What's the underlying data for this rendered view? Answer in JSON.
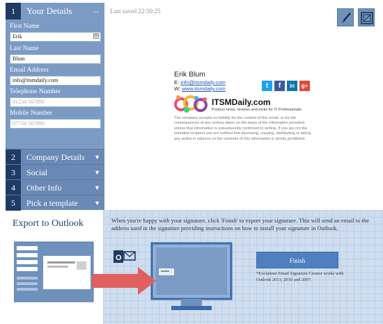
{
  "sidebar": {
    "step1": {
      "num": "1",
      "title": "Your Details",
      "more": "..."
    },
    "fields": [
      {
        "label": "First Name",
        "value": "Erik",
        "placeholder": ""
      },
      {
        "label": "Last Name",
        "value": "Blum",
        "placeholder": ""
      },
      {
        "label": "Email Address",
        "value": "info@itsmdaily.com",
        "placeholder": ""
      },
      {
        "label": "Telephone Number",
        "value": "",
        "placeholder": "01234 567890"
      },
      {
        "label": "Mobile Number",
        "value": "",
        "placeholder": "07734 567890"
      }
    ],
    "sections": [
      {
        "num": "2",
        "label": "Company Details"
      },
      {
        "num": "3",
        "label": "Social"
      },
      {
        "num": "4",
        "label": "Other Info"
      },
      {
        "num": "5",
        "label": "Pick a template"
      }
    ]
  },
  "header": {
    "last_saved": "Last saved 22:50:25",
    "tools": [
      "brush-icon",
      "layout-icon"
    ]
  },
  "signature": {
    "name": "Erik Blum",
    "email_prefix": "E:",
    "email": "info@itsmdaily.com",
    "web_prefix": "W:",
    "web": "www.itsmdaily.com",
    "social": [
      {
        "icon": "twitter-icon",
        "glyph": "t",
        "color": "#1ea1f2"
      },
      {
        "icon": "facebook-icon",
        "glyph": "f",
        "color": "#3b5998"
      },
      {
        "icon": "linkedin-icon",
        "glyph": "in",
        "color": "#0e76a8"
      },
      {
        "icon": "googleplus-icon",
        "glyph": "g+",
        "color": "#dd4b39"
      }
    ],
    "brand_name": "ITSMDaily.com",
    "brand_tagline": "Product news, reviews and tricks for IT Professionals",
    "disclaimer": "The company accepts no liability for the content of this email, or for the consequences of any actions taken on the basis of the information provided, unless that information is subsequently confirmed in writing. If you are not the intended recipient you are notified that disclosing, copying, distributing or taking any action in reliance on the contents of this information is strictly prohibited."
  },
  "export": {
    "title": "Export to Outlook",
    "instructions": "When you're happy with your signature, click 'Finish' to export your signature. This will send an email to the address used in the signature providing instructions on how to install your signature in Outlook.",
    "finish_label": "Finish",
    "note": "*Exclaimer Email Signature Creator works with Outlook 2013, 2010 and 2007."
  },
  "colors": {
    "sidebar": "#7b9bc4",
    "step_number": "#1f3a63",
    "panel": "#cfddef",
    "finish": "#4f7fbf",
    "arrow": "#e0605f"
  }
}
